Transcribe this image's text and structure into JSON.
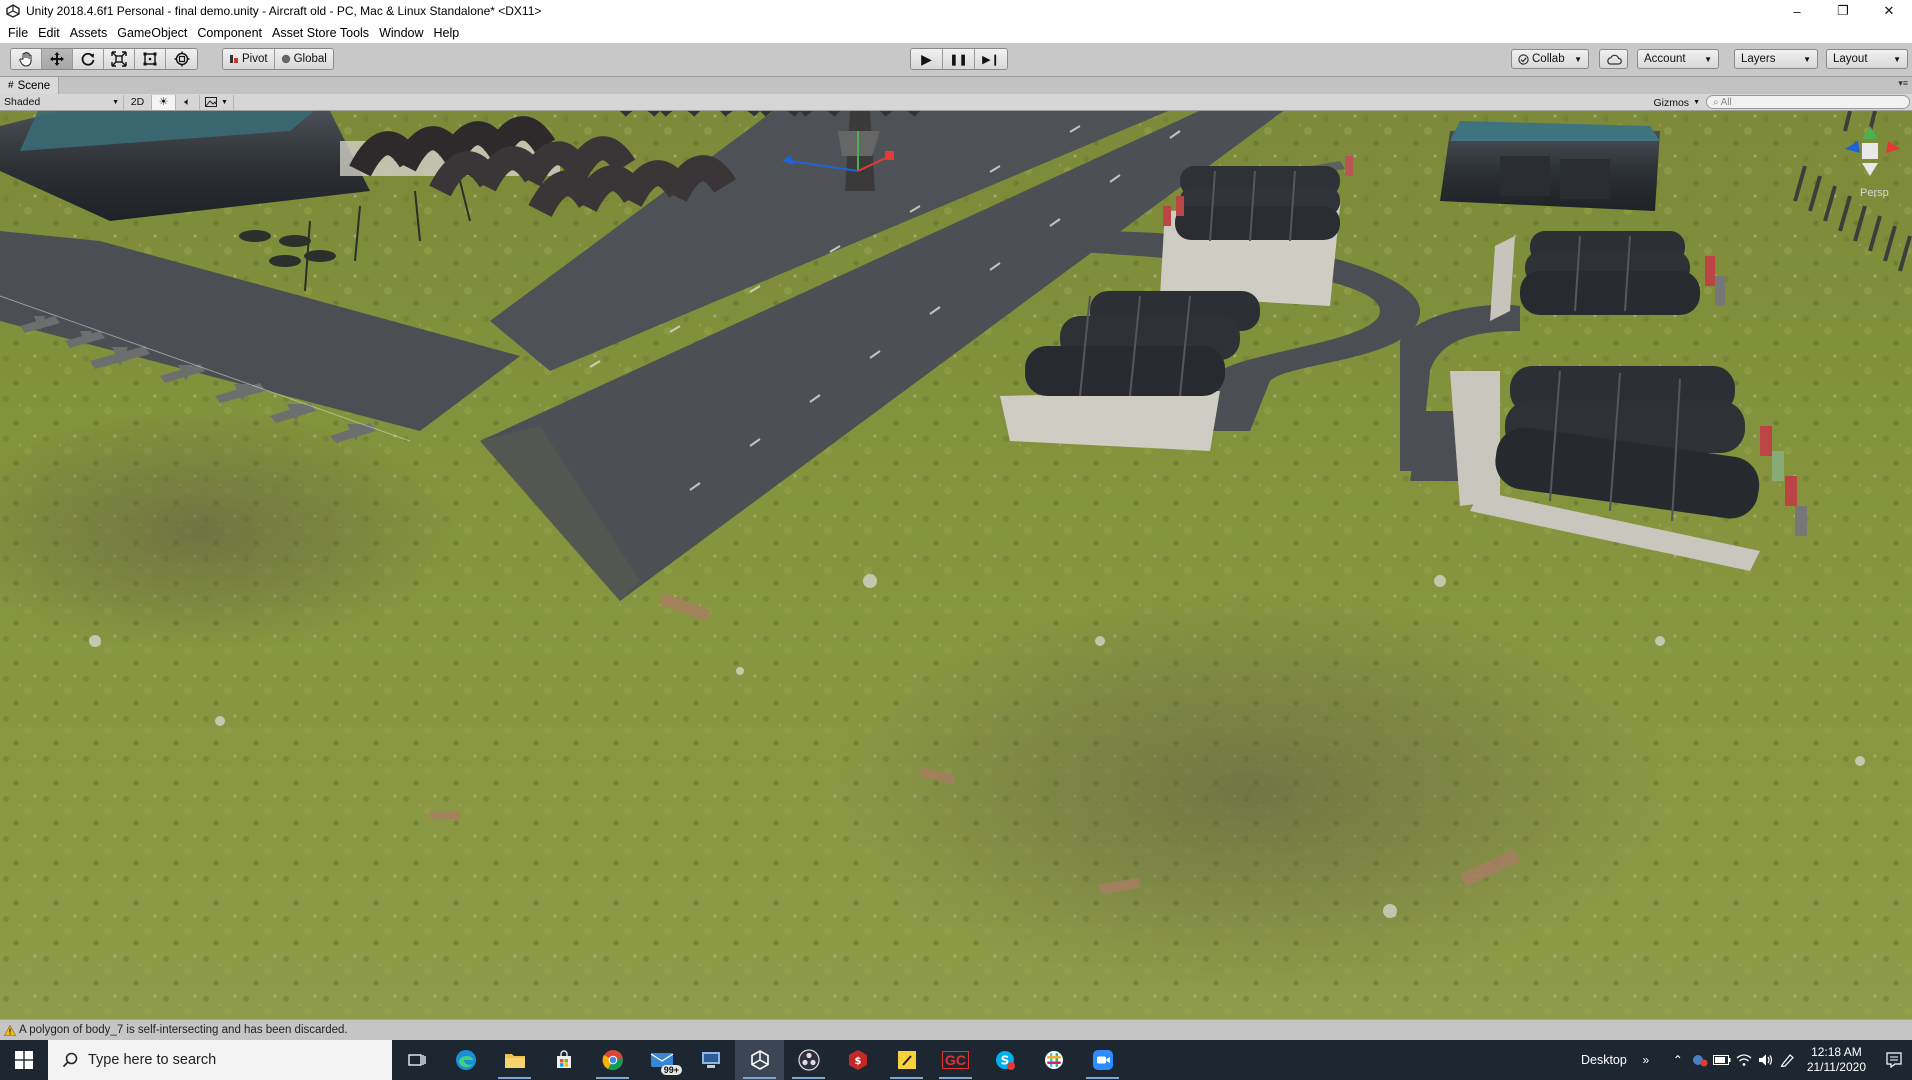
{
  "window": {
    "title": "Unity 2018.4.6f1 Personal - final demo.unity - Aircraft old - PC, Mac & Linux Standalone* <DX11>",
    "controls": {
      "minimize": "–",
      "restore": "❐",
      "close": "✕"
    }
  },
  "menu": [
    "File",
    "Edit",
    "Assets",
    "GameObject",
    "Component",
    "Asset Store Tools",
    "Window",
    "Help"
  ],
  "toolbar": {
    "tools": [
      "hand-tool",
      "move-tool",
      "rotate-tool",
      "scale-tool",
      "rect-tool",
      "transform-tool"
    ],
    "active_tool": "move-tool",
    "pivot_label": "Pivot",
    "global_label": "Global",
    "play_label": "▶",
    "pause_label": "❚❚",
    "step_label": "▶❙",
    "collab_label": "Collab",
    "account_label": "Account",
    "layers_label": "Layers",
    "layout_label": "Layout"
  },
  "scene_tab": {
    "label": "Scene",
    "icon": "#"
  },
  "scene_controls": {
    "shading_mode": "Shaded",
    "mode_2d": "2D",
    "gizmos_label": "Gizmos",
    "search_placeholder": "All"
  },
  "viewport": {
    "persp_label": "Persp",
    "colors": {
      "grass": "#7f8f3c",
      "asphalt": "#4a4e53",
      "hangar": "#2b2f34"
    }
  },
  "status": {
    "message": "A polygon of body_7 is self-intersecting and has been discarded."
  },
  "taskbar": {
    "search_placeholder": "Type here to search",
    "apps": [
      {
        "name": "task-view-icon",
        "label": ""
      },
      {
        "name": "edge-icon",
        "label": ""
      },
      {
        "name": "file-explorer-icon",
        "label": ""
      },
      {
        "name": "store-icon",
        "label": ""
      },
      {
        "name": "chrome-icon",
        "label": ""
      },
      {
        "name": "mail-icon",
        "label": "99+"
      },
      {
        "name": "network-app-icon",
        "label": ""
      },
      {
        "name": "unity-icon",
        "label": ""
      },
      {
        "name": "obs-icon",
        "label": ""
      },
      {
        "name": "app-s-icon",
        "label": ""
      },
      {
        "name": "sticky-notes-icon",
        "label": ""
      },
      {
        "name": "gc-icon",
        "label": "GC"
      },
      {
        "name": "skype-icon",
        "label": ""
      },
      {
        "name": "slack-icon",
        "label": ""
      },
      {
        "name": "zoom-icon",
        "label": ""
      }
    ],
    "desktop_label": "Desktop",
    "more_label": "»",
    "time": "12:18 AM",
    "date": "21/11/2020"
  }
}
